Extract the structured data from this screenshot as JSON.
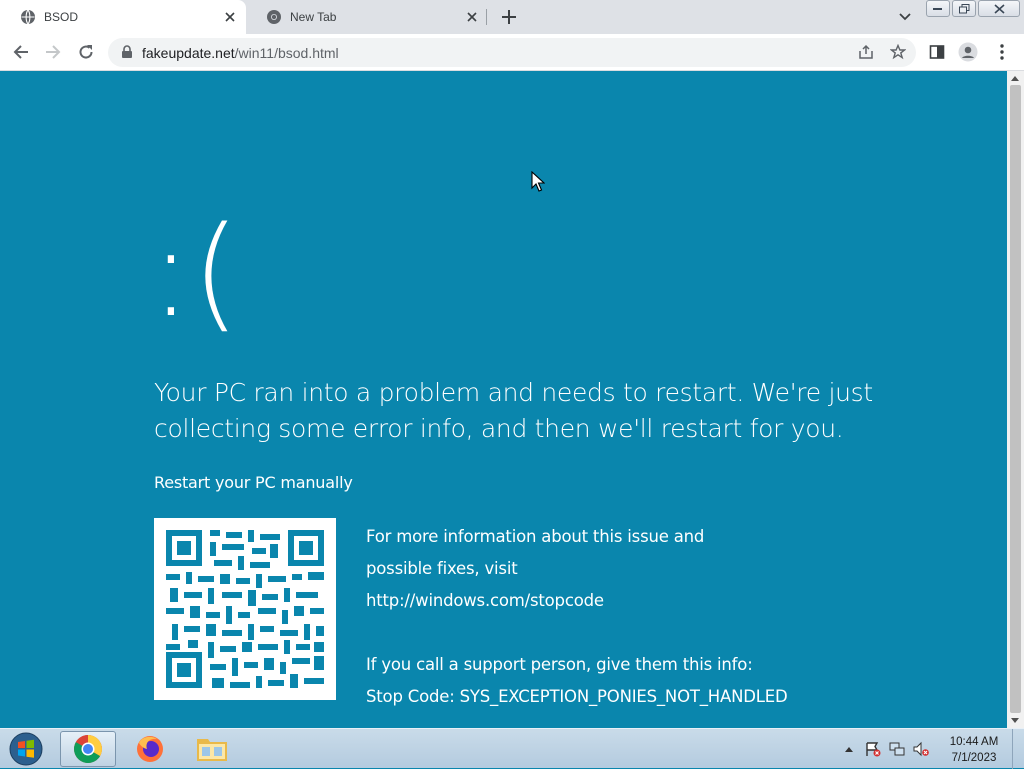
{
  "browser": {
    "tabs": [
      {
        "title": "BSOD",
        "active": true
      },
      {
        "title": "New Tab",
        "active": false
      }
    ],
    "url": {
      "host": "fakeupdate.net",
      "path": "/win11/bsod.html"
    }
  },
  "page": {
    "face": ":(",
    "headline": "Your PC ran into a problem and needs to restart. We're just collecting some error info, and then we'll restart for you.",
    "manual_restart": "Restart your PC manually",
    "info_lines": [
      "For more information about this issue and",
      "possible fixes, visit",
      "http://windows.com/stopcode",
      "",
      "If you call a support person, give them this info:",
      "Stop Code: SYS_EXCEPTION_PONIES_NOT_HANDLED"
    ],
    "background_color": "#0a86ad"
  },
  "taskbar": {
    "apps": [
      "chrome-icon",
      "firefox-icon",
      "file-explorer-icon"
    ],
    "clock": {
      "time": "10:44 AM",
      "date": "7/1/2023"
    }
  }
}
